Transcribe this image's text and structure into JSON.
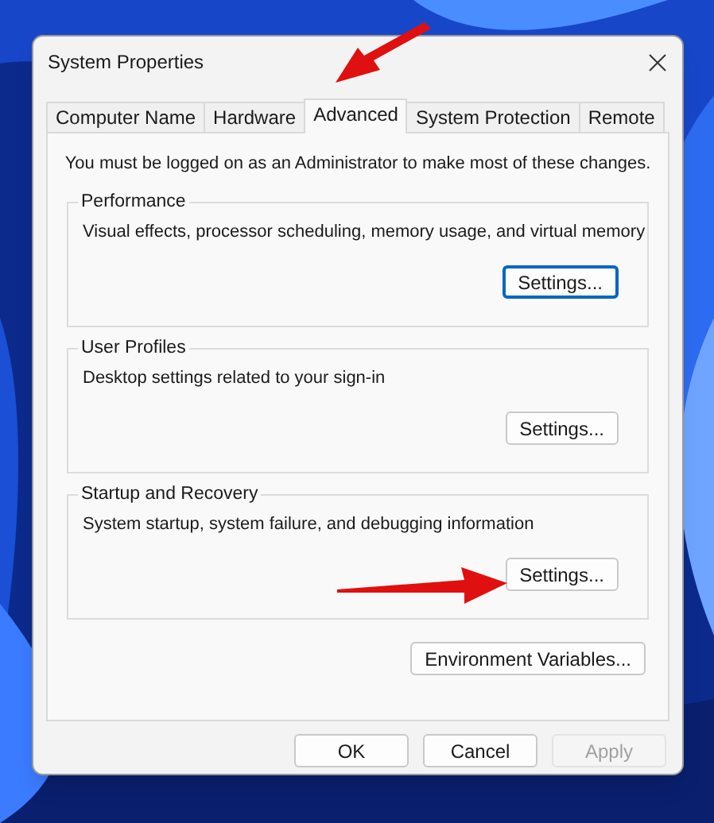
{
  "window": {
    "title": "System Properties"
  },
  "tabs": [
    {
      "label": "Computer Name",
      "selected": false
    },
    {
      "label": "Hardware",
      "selected": false
    },
    {
      "label": "Advanced",
      "selected": true
    },
    {
      "label": "System Protection",
      "selected": false
    },
    {
      "label": "Remote",
      "selected": false
    }
  ],
  "notice": "You must be logged on as an Administrator to make most of these changes.",
  "groups": [
    {
      "title": "Performance",
      "description": "Visual effects, processor scheduling, memory usage, and virtual memory",
      "button": {
        "label": "Settings...",
        "focused": true
      }
    },
    {
      "title": "User Profiles",
      "description": "Desktop settings related to your sign-in",
      "button": {
        "label": "Settings...",
        "focused": false
      }
    },
    {
      "title": "Startup and Recovery",
      "description": "System startup, system failure, and debugging information",
      "button": {
        "label": "Settings...",
        "focused": false
      }
    }
  ],
  "environment_button": {
    "label": "Environment Variables..."
  },
  "footer_buttons": [
    {
      "label": "OK",
      "disabled": false
    },
    {
      "label": "Cancel",
      "disabled": false
    },
    {
      "label": "Apply",
      "disabled": true
    }
  ]
}
